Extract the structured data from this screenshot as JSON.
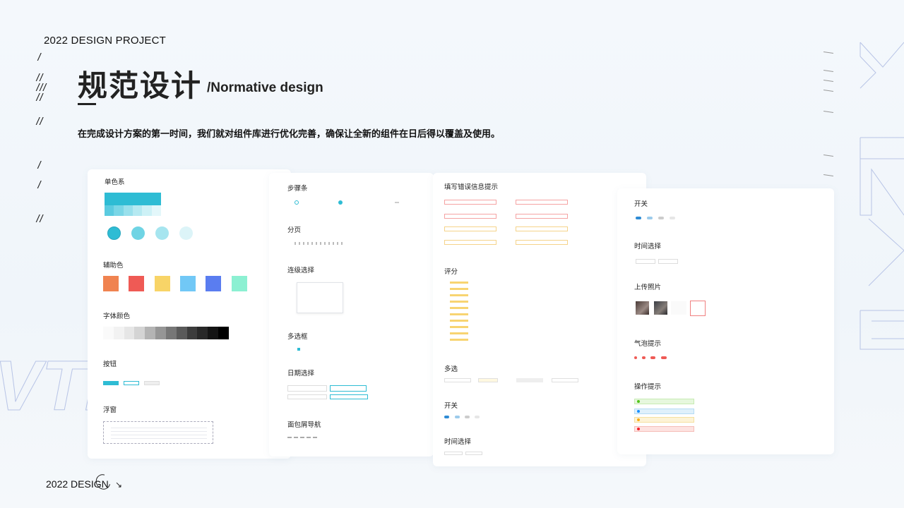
{
  "header": {
    "top_label": "2022 DESIGN PROJECT",
    "title_cn": "规范设计",
    "title_en": "/Normative design",
    "subtitle": "在完成设计方案的第一时间，我们就对组件库进行优化完善，确保让全新的组件在日后得以覆盖及使用。"
  },
  "footer": {
    "label": "2022 DESIGN"
  },
  "card1": {
    "single_color": "单色系",
    "aux_color": "辅助色",
    "font_color": "字体颜色",
    "button": "按钮",
    "popover": "浮窗",
    "aux_colors": [
      "#f08350",
      "#ef5a55",
      "#f8d467",
      "#71c8f6",
      "#5a7df0",
      "#8cf0d2"
    ],
    "font_swatches": [
      "#fafafa",
      "#f2f2f2",
      "#e6e6e6",
      "#d4d4d4",
      "#b4b4b4",
      "#969696",
      "#777777",
      "#5a5a5a",
      "#3c3c3c",
      "#282828",
      "#141414",
      "#000000"
    ]
  },
  "card2": {
    "steps": "步骤条",
    "pagination": "分页",
    "cascader": "连级选择",
    "checkbox": "多选框",
    "date_select": "日期选择",
    "breadcrumb": "面包屑导航"
  },
  "card3": {
    "form_error": "填写错误信息提示",
    "rating": "评分",
    "multi_select": "多选",
    "switch": "开关",
    "time_select": "时间选择"
  },
  "card4": {
    "switch": "开关",
    "time_select": "时间选择",
    "upload": "上传照片",
    "bubble": "气泡提示",
    "toast": "操作提示",
    "toast_colors": [
      "#e6f7dd",
      "#dff0fb",
      "#fdf3d6",
      "#fde3e1"
    ],
    "toast_dot_colors": [
      "#52c41a",
      "#1890ff",
      "#faad14",
      "#f5222d"
    ]
  },
  "colors": {
    "primary": "#2ebcd4"
  }
}
